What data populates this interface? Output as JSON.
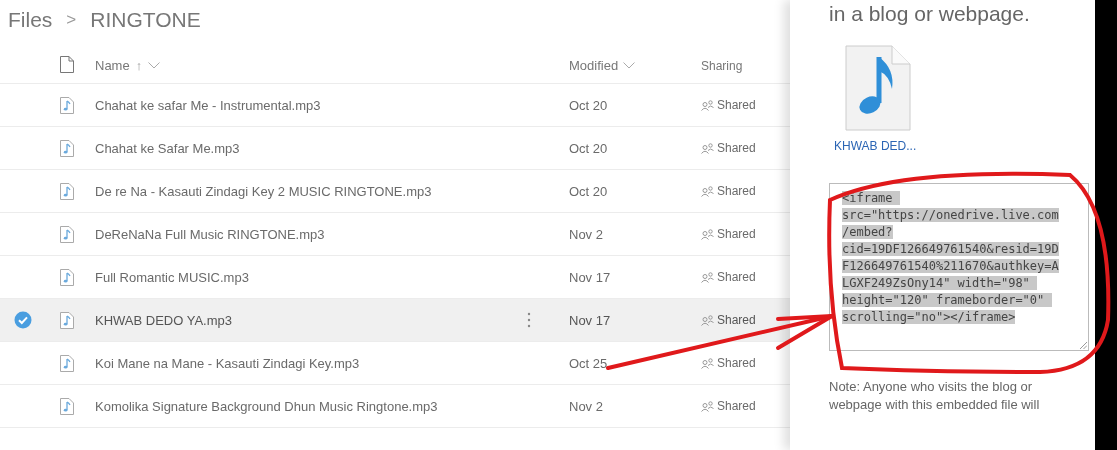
{
  "breadcrumb": [
    {
      "label": "Files"
    },
    {
      "label": "RINGTONE"
    }
  ],
  "breadcrumb_separator": ">",
  "columns": {
    "name": "Name",
    "name_sort": "↑",
    "modified": "Modified",
    "sharing": "Sharing"
  },
  "files": [
    {
      "name": "Chahat ke safar Me - Instrumental.mp3",
      "modified": "Oct 20",
      "sharing": "Shared",
      "selected": false
    },
    {
      "name": "Chahat ke Safar Me.mp3",
      "modified": "Oct 20",
      "sharing": "Shared",
      "selected": false
    },
    {
      "name": "De re Na - Kasauti Zindagi Key 2 MUSIC RINGTONE.mp3",
      "modified": "Oct 20",
      "sharing": "Shared",
      "selected": false
    },
    {
      "name": "DeReNaNa Full Music RINGTONE.mp3",
      "modified": "Nov 2",
      "sharing": "Shared",
      "selected": false
    },
    {
      "name": "Full Romantic MUSIC.mp3",
      "modified": "Nov 17",
      "sharing": "Shared",
      "selected": false
    },
    {
      "name": "KHWAB DEDO YA.mp3",
      "modified": "Nov 17",
      "sharing": "Shared",
      "selected": true
    },
    {
      "name": "Koi Mane na Mane - Kasauti Zindagi Key.mp3",
      "modified": "Oct 25",
      "sharing": "Shared",
      "selected": false
    },
    {
      "name": "Komolika Signature Background Dhun Music Ringtone.mp3",
      "modified": "Nov 2",
      "sharing": "Shared",
      "selected": false
    }
  ],
  "embed_panel": {
    "heading": "in a blog or webpage.",
    "file_label": "KHWAB DED...",
    "code": "<iframe \nsrc=\"https://onedrive.live.com\n/embed?\ncid=19DF126649761540&resid=19D\nF126649761540%211670&authkey=A\nLGXF249ZsOny14\" width=\"98\" \nheight=\"120\" frameborder=\"0\" \nscrolling=\"no\"></iframe>",
    "note": "Note: Anyone who visits the blog or webpage with this embedded file will"
  }
}
